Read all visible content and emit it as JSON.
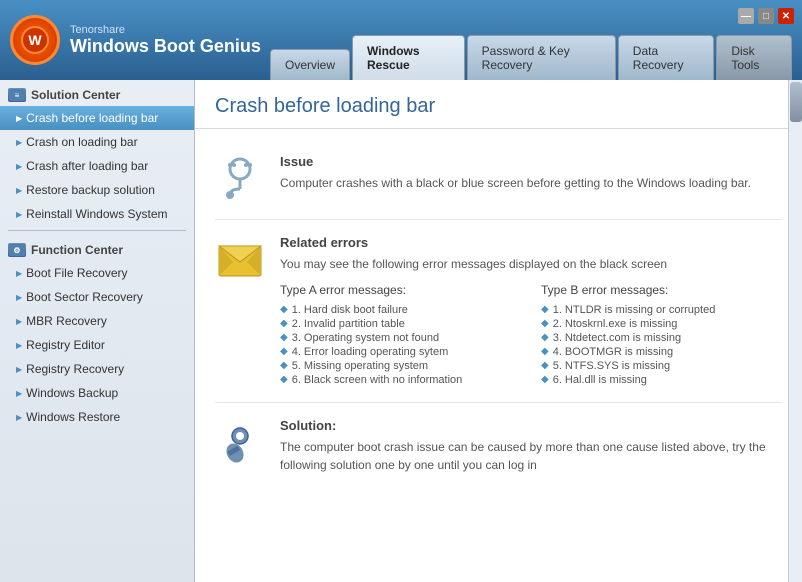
{
  "header": {
    "brand": "Tenorshare",
    "product": "Windows Boot Genius",
    "logo_symbol": "🔄"
  },
  "nav": {
    "tabs": [
      {
        "id": "overview",
        "label": "Overview",
        "active": false
      },
      {
        "id": "windows-rescue",
        "label": "Windows Rescue",
        "active": true
      },
      {
        "id": "password-key-recovery",
        "label": "Password & Key Recovery",
        "active": false
      },
      {
        "id": "data-recovery",
        "label": "Data Recovery",
        "active": false
      },
      {
        "id": "disk-tools",
        "label": "Disk Tools",
        "active": false
      }
    ]
  },
  "sidebar": {
    "section1_label": "Solution Center",
    "items1": [
      {
        "id": "crash-before",
        "label": "Crash before loading bar",
        "active": true
      },
      {
        "id": "crash-on",
        "label": "Crash on loading bar",
        "active": false
      },
      {
        "id": "crash-after",
        "label": "Crash after loading bar",
        "active": false
      },
      {
        "id": "restore-backup",
        "label": "Restore backup solution",
        "active": false
      },
      {
        "id": "reinstall-windows",
        "label": "Reinstall Windows System",
        "active": false
      }
    ],
    "section2_label": "Function Center",
    "items2": [
      {
        "id": "boot-file",
        "label": "Boot File Recovery",
        "active": false
      },
      {
        "id": "boot-sector",
        "label": "Boot Sector Recovery",
        "active": false
      },
      {
        "id": "mbr-recovery",
        "label": "MBR Recovery",
        "active": false
      },
      {
        "id": "registry-editor",
        "label": "Registry Editor",
        "active": false
      },
      {
        "id": "registry-recovery",
        "label": "Registry Recovery",
        "active": false
      },
      {
        "id": "windows-backup",
        "label": "Windows Backup",
        "active": false
      },
      {
        "id": "windows-restore",
        "label": "Windows Restore",
        "active": false
      }
    ]
  },
  "content": {
    "title": "Crash before loading bar",
    "issue_title": "Issue",
    "issue_text": "Computer crashes with a black or blue screen before getting to the Windows loading bar.",
    "related_title": "Related errors",
    "related_subtitle": "You may see the following error messages displayed on the black screen",
    "errors_col_a_title": "Type A error messages:",
    "errors_col_b_title": "Type B error messages:",
    "errors_col_a": [
      "1. Hard disk boot failure",
      "2. Invalid partition table",
      "3. Operating system not found",
      "4. Error loading operating sytem",
      "5. Missing operating system",
      "6. Black screen with no information"
    ],
    "errors_col_b": [
      "1. NTLDR is missing or corrupted",
      "2. Ntoskrnl.exe is missing",
      "3. Ntdetect.com is missing",
      "4. BOOTMGR is missing",
      "5. NTFS.SYS is missing",
      "6. Hal.dll is missing"
    ],
    "solution_title": "Solution:",
    "solution_text": "The computer boot crash issue can be caused by more than one cause listed above, try the following solution one by one until you can log in"
  },
  "win_controls": {
    "minimize": "—",
    "maximize": "□",
    "close": "✕"
  }
}
